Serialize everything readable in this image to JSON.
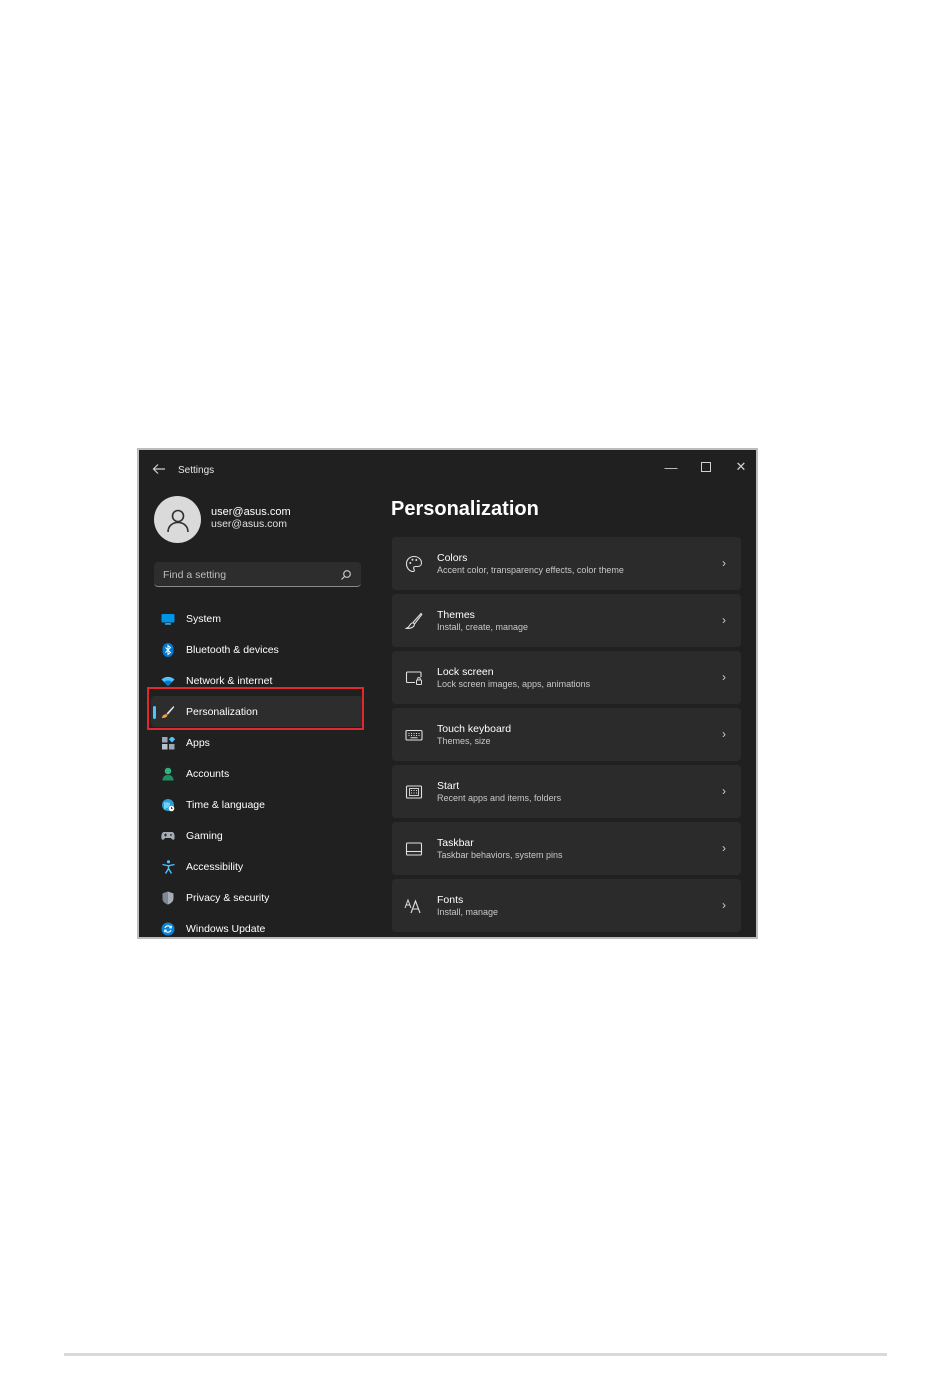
{
  "window": {
    "app_title": "Settings",
    "controls": {
      "minimize": "—",
      "maximize": "☐",
      "close": "✕"
    }
  },
  "user": {
    "name": "user@asus.com",
    "email": "user@asus.com"
  },
  "search": {
    "placeholder": "Find a setting"
  },
  "nav": {
    "items": [
      {
        "label": "System",
        "icon": "system-icon"
      },
      {
        "label": "Bluetooth & devices",
        "icon": "bluetooth-icon"
      },
      {
        "label": "Network & internet",
        "icon": "wifi-icon"
      },
      {
        "label": "Personalization",
        "icon": "brush-icon",
        "active": true
      },
      {
        "label": "Apps",
        "icon": "apps-icon"
      },
      {
        "label": "Accounts",
        "icon": "accounts-icon"
      },
      {
        "label": "Time & language",
        "icon": "globe-icon"
      },
      {
        "label": "Gaming",
        "icon": "gamepad-icon"
      },
      {
        "label": "Accessibility",
        "icon": "accessibility-icon"
      },
      {
        "label": "Privacy & security",
        "icon": "shield-icon"
      },
      {
        "label": "Windows Update",
        "icon": "update-icon"
      }
    ]
  },
  "main": {
    "title": "Personalization",
    "cards": [
      {
        "title": "Colors",
        "subtitle": "Accent color, transparency effects, color theme",
        "icon": "palette-icon"
      },
      {
        "title": "Themes",
        "subtitle": "Install, create, manage",
        "icon": "brush-icon"
      },
      {
        "title": "Lock screen",
        "subtitle": "Lock screen images, apps, animations",
        "icon": "lock-screen-icon"
      },
      {
        "title": "Touch keyboard",
        "subtitle": "Themes, size",
        "icon": "keyboard-icon"
      },
      {
        "title": "Start",
        "subtitle": "Recent apps and items, folders",
        "icon": "start-icon"
      },
      {
        "title": "Taskbar",
        "subtitle": "Taskbar behaviors, system pins",
        "icon": "taskbar-icon"
      },
      {
        "title": "Fonts",
        "subtitle": "Install, manage",
        "icon": "fonts-icon"
      }
    ],
    "chevron": "›"
  },
  "colors": {
    "accent": "#4cc2ff",
    "highlight_box": "#e0282e",
    "window_bg": "#202020",
    "card_bg": "#2b2b2b"
  }
}
